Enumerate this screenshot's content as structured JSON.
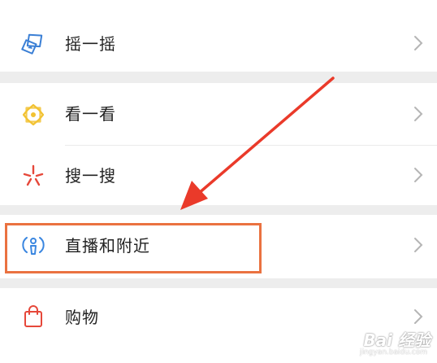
{
  "menu": {
    "items": [
      {
        "label": "摇一摇",
        "icon": "shake-icon"
      },
      {
        "label": "看一看",
        "icon": "top-stories-icon"
      },
      {
        "label": "搜一搜",
        "icon": "search-sparkle-icon"
      },
      {
        "label": "直播和附近",
        "icon": "live-nearby-icon"
      },
      {
        "label": "购物",
        "icon": "shopping-bag-icon"
      }
    ]
  },
  "annotation": {
    "color": "#ea3a2a",
    "box_color": "#ea7240"
  },
  "watermark": {
    "brand": "Bai 经验",
    "url": "jingyan.baidu.com"
  }
}
